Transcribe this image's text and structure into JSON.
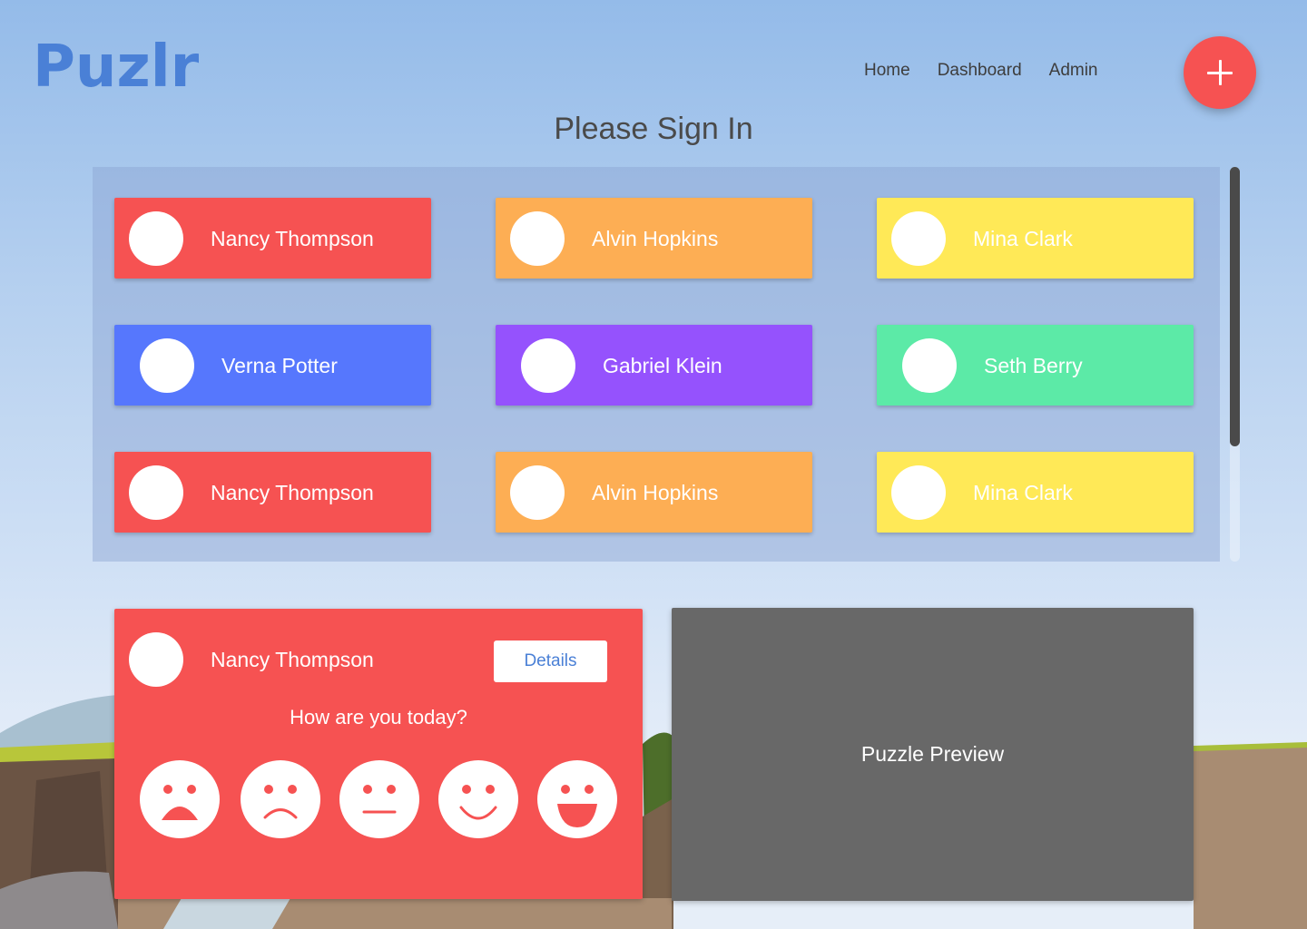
{
  "app": {
    "title": "Puzlr"
  },
  "nav": {
    "items": [
      "Home",
      "Dashboard",
      "Admin"
    ]
  },
  "fab": {
    "icon": "plus-icon"
  },
  "page": {
    "heading": "Please Sign In"
  },
  "users": [
    {
      "name": "Nancy Thompson",
      "color": "#f65252"
    },
    {
      "name": "Alvin Hopkins",
      "color": "#fdae54"
    },
    {
      "name": "Mina Clark",
      "color": "#ffe957"
    },
    {
      "name": "Verna Potter",
      "color": "#5677fd"
    },
    {
      "name": "Gabriel Klein",
      "color": "#9552fd"
    },
    {
      "name": "Seth Berry",
      "color": "#5ceaa7"
    },
    {
      "name": "Nancy Thompson",
      "color": "#f65252"
    },
    {
      "name": "Alvin Hopkins",
      "color": "#fdae54"
    },
    {
      "name": "Mina Clark",
      "color": "#ffe957"
    }
  ],
  "mood": {
    "user_name": "Nancy Thompson",
    "details_label": "Details",
    "question": "How are you today?",
    "faces": [
      "very-sad-face-icon",
      "sad-face-icon",
      "neutral-face-icon",
      "happy-face-icon",
      "very-happy-face-icon"
    ],
    "color": "#f65252"
  },
  "preview": {
    "label": "Puzzle Preview"
  },
  "colors": {
    "accent": "#4a80d6",
    "fab": "#f65252",
    "preview_bg": "#686868"
  }
}
